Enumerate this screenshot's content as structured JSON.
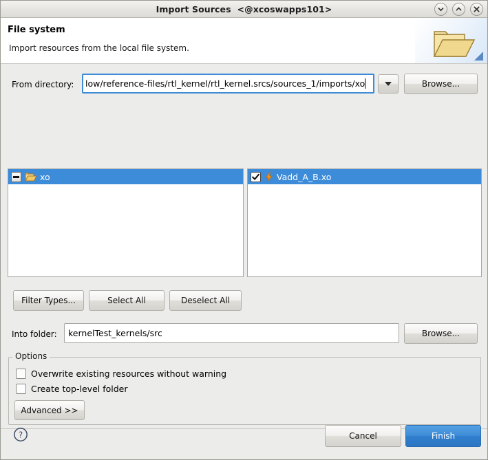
{
  "window": {
    "title": "Import Sources  <@xcoswapps101>",
    "controls": [
      {
        "name": "minimize",
        "glyph": "chevron-down"
      },
      {
        "name": "maximize",
        "glyph": "chevron-up"
      },
      {
        "name": "close",
        "glyph": "x"
      }
    ]
  },
  "header": {
    "title": "File system",
    "description": "Import resources from the local file system.",
    "icon": "open-folder-icon"
  },
  "from_directory": {
    "label": "From directory:",
    "value": "low/reference-files/rtl_kernel/rtl_kernel.srcs/sources_1/imports/xo",
    "dropdown_icon": "chevron-down-icon",
    "browse_label": "Browse..."
  },
  "trees": {
    "left": {
      "rows": [
        {
          "label": "xo",
          "icon": "folder-icon",
          "expander": "minus",
          "selected": true
        }
      ]
    },
    "right": {
      "rows": [
        {
          "label": "Vadd_A_B.xo",
          "icon": "bolt-icon",
          "checked": true,
          "selected": true
        }
      ]
    }
  },
  "selection_buttons": {
    "filter_types": "Filter Types...",
    "select_all": "Select All",
    "deselect_all": "Deselect All"
  },
  "into_folder": {
    "label": "Into folder:",
    "value": "kernelTest_kernels/src",
    "browse_label": "Browse..."
  },
  "options": {
    "legend": "Options",
    "items": [
      {
        "label": "Overwrite existing resources without warning",
        "checked": false
      },
      {
        "label": "Create top-level folder",
        "checked": false
      }
    ],
    "advanced_label": "Advanced >>"
  },
  "footer": {
    "help_icon": "help-icon",
    "cancel_label": "Cancel",
    "finish_label": "Finish"
  },
  "colors": {
    "selection_blue": "#3d8cd9",
    "primary_button": "#3f8dd8",
    "focus_border": "#3e8bd8",
    "dialog_bg": "#ececea"
  }
}
